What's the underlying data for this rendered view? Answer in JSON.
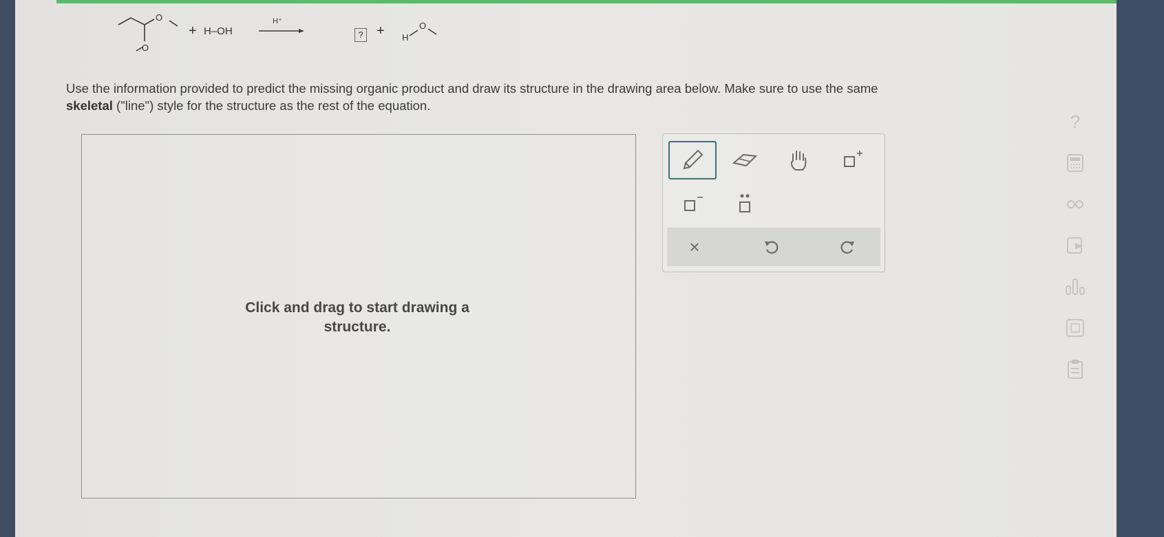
{
  "equation": {
    "reactant_o_top": "O",
    "reactant_o_bottom": "O",
    "plus_1": "+",
    "water": "H–OH",
    "catalyst": "H⁺",
    "missing_product": "?",
    "plus_2": "+",
    "methanol_h": "H",
    "methanol_o": "O"
  },
  "instructions": {
    "text_part1": "Use the information provided to predict the missing organic product and draw its structure in the drawing area below. Make sure to use the same",
    "bold": "skeletal",
    "text_part2": " (\"line\") style for the structure as the rest of the equation."
  },
  "drawing_area": {
    "hint_line1": "Click and drag to start drawing a",
    "hint_line2": "structure."
  },
  "toolbar": {
    "tools": [
      "pencil-icon",
      "eraser-icon",
      "hand-icon",
      "add-positive-charge-icon",
      "add-negative-charge-icon",
      "add-lone-pair-icon"
    ],
    "actions": [
      "clear-icon",
      "undo-icon",
      "redo-icon"
    ],
    "clear_label": "×"
  },
  "sidebar": {
    "help_label": "?",
    "icons": [
      "calculator-icon",
      "infinity-icon",
      "book-icon",
      "bar-chart-icon",
      "periodic-table-icon",
      "clipboard-icon"
    ]
  },
  "colors": {
    "accent": "#5bbb6c",
    "selected_tool_border": "#3f6f7e",
    "action_bar": "#d6d6d5"
  }
}
